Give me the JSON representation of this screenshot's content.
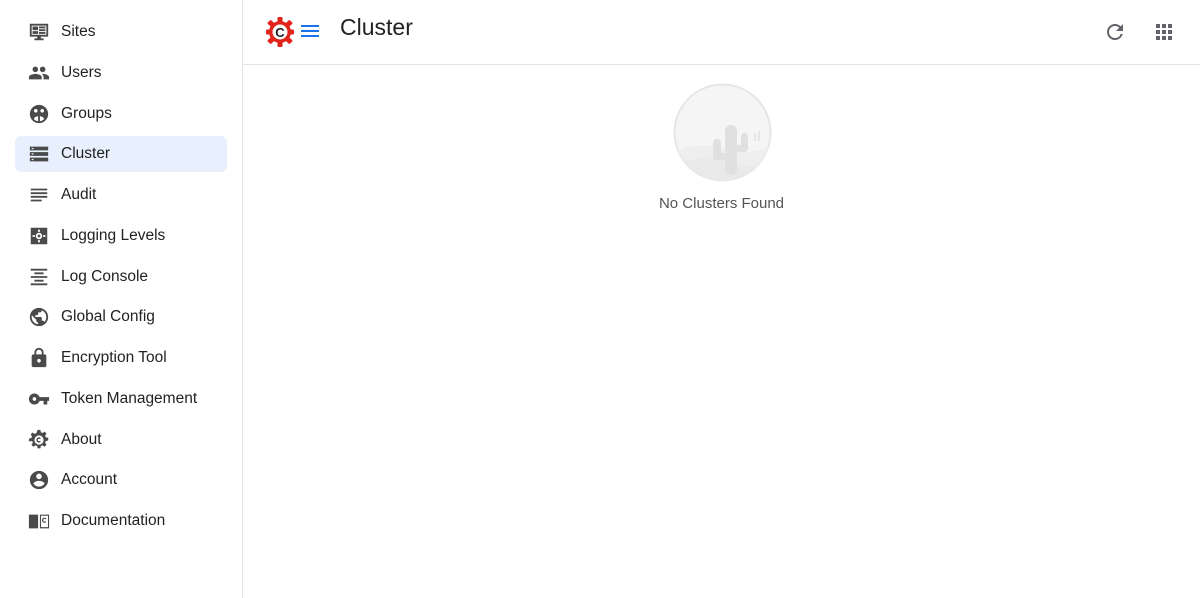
{
  "sidebar": {
    "items": [
      {
        "label": "Sites",
        "icon": "sites-icon"
      },
      {
        "label": "Users",
        "icon": "users-icon"
      },
      {
        "label": "Groups",
        "icon": "groups-icon"
      },
      {
        "label": "Cluster",
        "icon": "cluster-icon",
        "active": true
      },
      {
        "label": "Audit",
        "icon": "audit-icon"
      },
      {
        "label": "Logging Levels",
        "icon": "logging-levels-icon"
      },
      {
        "label": "Log Console",
        "icon": "log-console-icon"
      },
      {
        "label": "Global Config",
        "icon": "globe-icon"
      },
      {
        "label": "Encryption Tool",
        "icon": "lock-icon"
      },
      {
        "label": "Token Management",
        "icon": "key-icon"
      },
      {
        "label": "About",
        "icon": "about-gear-icon"
      },
      {
        "label": "Account",
        "icon": "account-icon"
      },
      {
        "label": "Documentation",
        "icon": "documentation-icon"
      }
    ]
  },
  "header": {
    "title": "Cluster",
    "logo_letter": "C"
  },
  "main": {
    "empty_message": "No Clusters Found"
  },
  "colors": {
    "active_bg": "#e8f0fe",
    "brand_red": "#e2231a",
    "menu_blue": "#1a73e8",
    "icon_gray": "#4a4a4a"
  }
}
